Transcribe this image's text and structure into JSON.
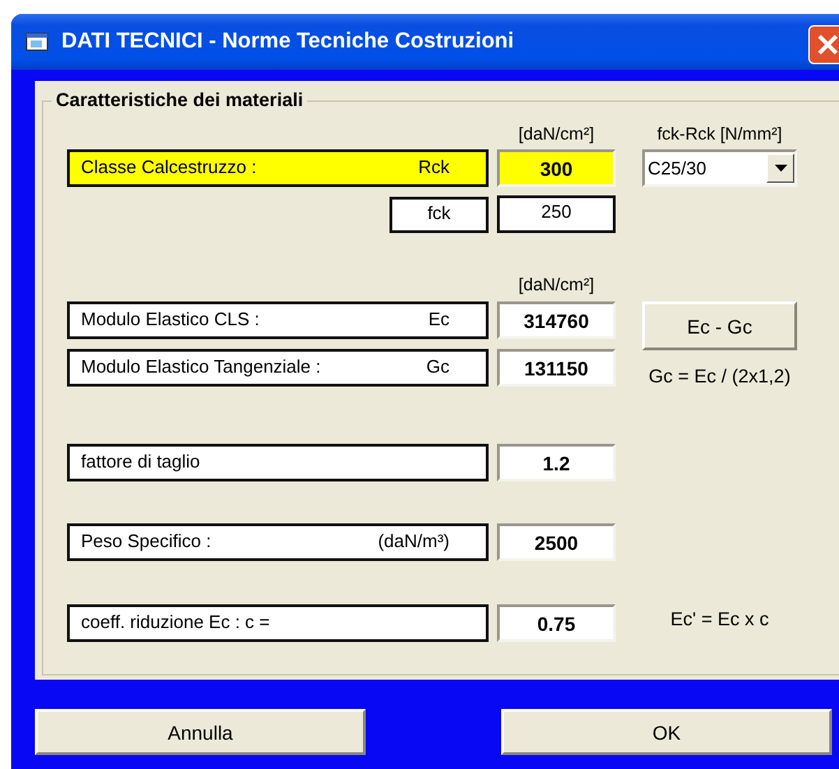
{
  "window": {
    "title": "DATI TECNICI - Norme Tecniche Costruzioni"
  },
  "group": {
    "title": "Caratteristiche dei materiali"
  },
  "concrete": {
    "unit": "[daN/cm²]",
    "combo_label": "fck-Rck [N/mm²]",
    "combo_value": "C25/30",
    "class_row": {
      "label": "Classe Calcestruzzo :",
      "symbol": "Rck",
      "value": "300",
      "highlighted": true
    },
    "fck_row": {
      "symbol": "fck",
      "value": "250",
      "highlighted": false
    }
  },
  "elastic": {
    "unit": "[daN/cm²]",
    "button": "Ec - Gc",
    "formula": "Gc = Ec / (2x1,2)",
    "rows": [
      {
        "label": "Modulo Elastico CLS  :",
        "symbol": "Ec",
        "value": "314760",
        "highlighted": false
      },
      {
        "label": "Modulo Elastico Tangenziale   :",
        "symbol": "Gc",
        "value": "131150",
        "highlighted": false
      }
    ]
  },
  "shear_factor": {
    "label": "fattore di taglio",
    "value": "1.2",
    "highlighted": false
  },
  "specific_weight": {
    "label": "Peso Specifico   :",
    "symbol": "(daN/m³)",
    "value": "2500",
    "highlighted": false
  },
  "reduction": {
    "label": "coeff. riduzione Ec : c =",
    "value": "0.75",
    "formula": "Ec' = Ec x c",
    "highlighted": false
  },
  "buttons": [
    "Annulla",
    "OK"
  ]
}
